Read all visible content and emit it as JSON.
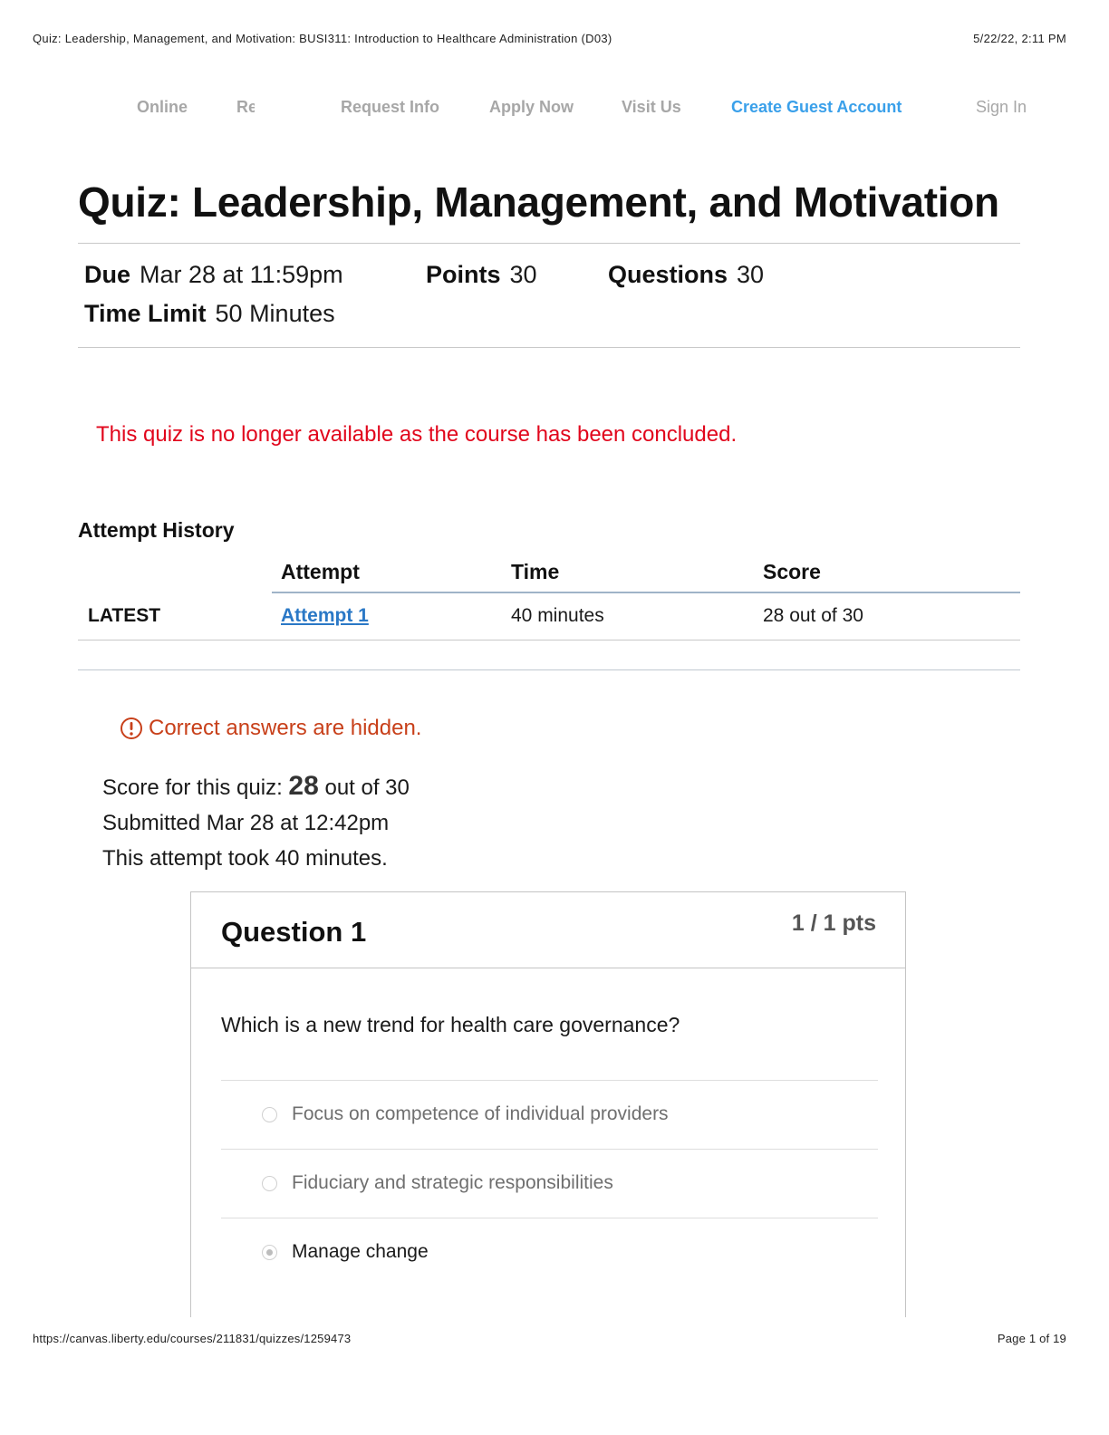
{
  "print_header": {
    "title": "Quiz: Leadership, Management, and Motivation: BUSI311: Introduction to Healthcare Administration (D03)",
    "datetime": "5/22/22, 2:11 PM"
  },
  "nav": {
    "online": "Online",
    "re": "Re",
    "request_info": "Request Info",
    "apply_now": "Apply Now",
    "visit_us": "Visit Us",
    "create_guest": "Create Guest Account",
    "sign_in": "Sign In"
  },
  "quiz": {
    "title": "Quiz: Leadership, Management, and Motivation",
    "due_label": "Due",
    "due_value": "Mar 28 at 11:59pm",
    "points_label": "Points",
    "points_value": "30",
    "questions_label": "Questions",
    "questions_value": "30",
    "time_limit_label": "Time Limit",
    "time_limit_value": "50 Minutes",
    "concluded_notice": "This quiz is no longer available as the course has been concluded."
  },
  "attempt_history": {
    "heading": "Attempt History",
    "columns": [
      "Attempt",
      "Time",
      "Score"
    ],
    "rows": [
      {
        "tag": "LATEST",
        "attempt": "Attempt 1 ",
        "time": "40 minutes",
        "score": "28 out of 30"
      }
    ]
  },
  "result": {
    "hidden_notice": "Correct answers are hidden.",
    "score_prefix": "Score for this quiz: ",
    "score_value": "28",
    "score_suffix": " out of 30",
    "submitted": "Submitted Mar 28 at 12:42pm",
    "duration": "This attempt took 40 minutes."
  },
  "question": {
    "title": "Question 1",
    "points": "1 / 1 pts",
    "text": "Which is a new trend for health care governance?",
    "answers": [
      {
        "label": "Focus on competence of individual providers",
        "selected": false
      },
      {
        "label": "Fiduciary and strategic responsibilities",
        "selected": false
      },
      {
        "label": "Manage change",
        "selected": true
      }
    ]
  },
  "print_footer": {
    "url": "https://canvas.liberty.edu/courses/211831/quizzes/1259473",
    "page": "Page 1 of 19"
  },
  "colors": {
    "nav_muted": "#a7a7a7",
    "nav_accent": "#3aa0ea",
    "alert_red": "#e1061c",
    "warning_orange": "#c8401a",
    "link_blue": "#2a78c6"
  }
}
